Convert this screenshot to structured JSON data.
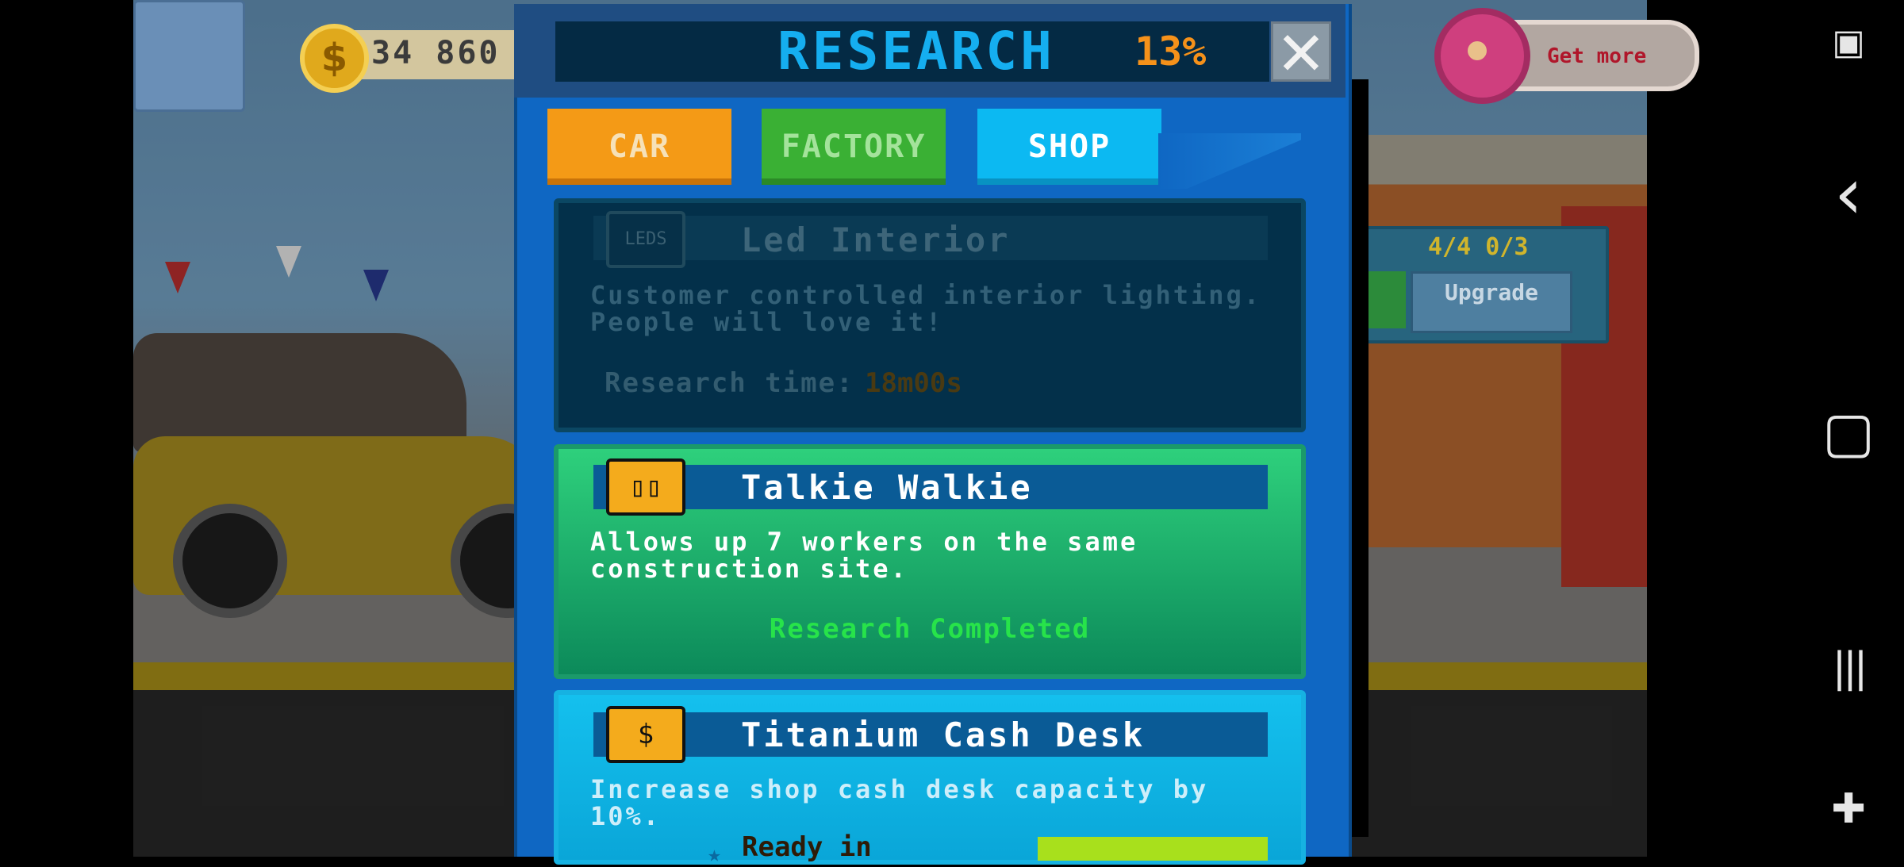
{
  "hud": {
    "coins": "34 860",
    "get_more_label": "Get more",
    "stats": "4/4  0/3",
    "upgrade_label": "Upgrade"
  },
  "research": {
    "title": "RESEARCH",
    "percent": "13%",
    "close_symbol": "✕",
    "tabs": [
      {
        "label": "CAR"
      },
      {
        "label": "FACTORY"
      },
      {
        "label": "SHOP"
      }
    ],
    "items": [
      {
        "title": "Led Interior",
        "icon_text": "LEDS",
        "description": "Customer controlled interior lighting. People will love it!",
        "time_label": "Research time:",
        "time_value": "18m00s"
      },
      {
        "title": "Talkie Walkie",
        "icon_text": "▯▯",
        "description": "Allows up 7 workers on the same construction site.",
        "status": "Research Completed"
      },
      {
        "title": "Titanium Cash Desk",
        "icon_text": "$",
        "description": "Increase shop cash desk capacity by 10%.",
        "ready_label": "Ready in"
      }
    ]
  },
  "nav": {
    "screenshot_icon": "screenshot-icon",
    "back_icon": "‹",
    "home_icon": "▢",
    "recents_icon": "|||",
    "game_icon": "gamepad-icon"
  }
}
